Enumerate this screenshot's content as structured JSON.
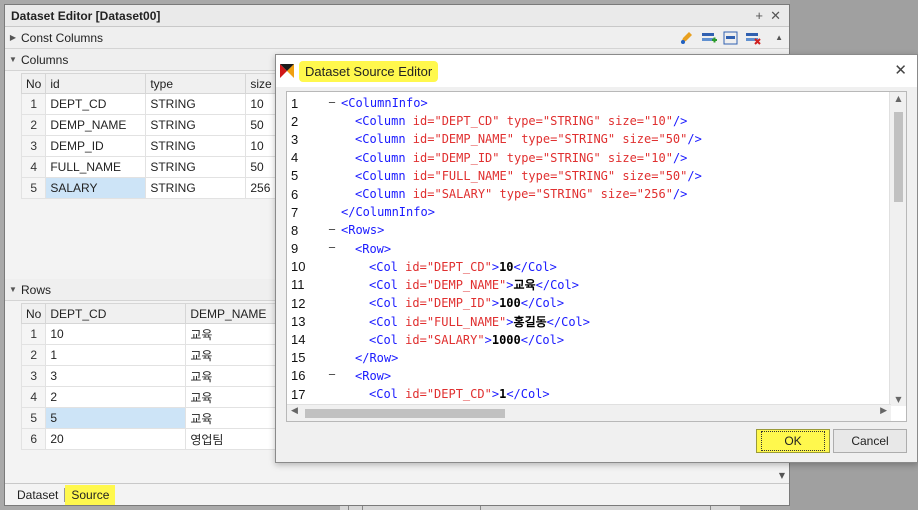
{
  "editor": {
    "title": "Dataset Editor [Dataset00]",
    "pin": "+",
    "close": "✕",
    "const_columns": "Const Columns",
    "columns_section": "Columns",
    "rows_section": "Rows",
    "columns_headers": [
      "No",
      "id",
      "type",
      "size"
    ],
    "columns_rows": [
      {
        "no": "1",
        "id": "DEPT_CD",
        "type": "STRING",
        "size": "10"
      },
      {
        "no": "2",
        "id": "DEMP_NAME",
        "type": "STRING",
        "size": "50"
      },
      {
        "no": "3",
        "id": "DEMP_ID",
        "type": "STRING",
        "size": "10"
      },
      {
        "no": "4",
        "id": "FULL_NAME",
        "type": "STRING",
        "size": "50"
      },
      {
        "no": "5",
        "id": "SALARY",
        "type": "STRING",
        "size": "256"
      }
    ],
    "rows_headers": [
      "No",
      "DEPT_CD",
      "DEMP_NAME"
    ],
    "rows_data": [
      {
        "no": "1",
        "a": "10",
        "b": "교육"
      },
      {
        "no": "2",
        "a": "1",
        "b": "교육"
      },
      {
        "no": "3",
        "a": "3",
        "b": "교육"
      },
      {
        "no": "4",
        "a": "2",
        "b": "교육"
      },
      {
        "no": "5",
        "a": "5",
        "b": "교육"
      },
      {
        "no": "6",
        "a": "20",
        "b": "영업팀"
      }
    ],
    "tabs": {
      "dataset": "Dataset",
      "source": "Source"
    }
  },
  "dialog": {
    "title": "Dataset Source Editor",
    "close": "✕",
    "ok": "OK",
    "cancel": "Cancel",
    "lines": [
      {
        "n": "1",
        "fold": "─",
        "ind": 0,
        "parts": [
          [
            "tag",
            "<ColumnInfo>"
          ]
        ]
      },
      {
        "n": "2",
        "fold": "",
        "ind": 1,
        "parts": [
          [
            "tag",
            "<Column "
          ],
          [
            "attr",
            "id="
          ],
          [
            "val",
            "\"DEPT_CD\""
          ],
          [
            "attr",
            " type="
          ],
          [
            "val",
            "\"STRING\""
          ],
          [
            "attr",
            " size="
          ],
          [
            "val",
            "\"10\""
          ],
          [
            "tag",
            "/>"
          ]
        ]
      },
      {
        "n": "3",
        "fold": "",
        "ind": 1,
        "parts": [
          [
            "tag",
            "<Column "
          ],
          [
            "attr",
            "id="
          ],
          [
            "val",
            "\"DEMP_NAME\""
          ],
          [
            "attr",
            " type="
          ],
          [
            "val",
            "\"STRING\""
          ],
          [
            "attr",
            " size="
          ],
          [
            "val",
            "\"50\""
          ],
          [
            "tag",
            "/>"
          ]
        ]
      },
      {
        "n": "4",
        "fold": "",
        "ind": 1,
        "parts": [
          [
            "tag",
            "<Column "
          ],
          [
            "attr",
            "id="
          ],
          [
            "val",
            "\"DEMP_ID\""
          ],
          [
            "attr",
            " type="
          ],
          [
            "val",
            "\"STRING\""
          ],
          [
            "attr",
            " size="
          ],
          [
            "val",
            "\"10\""
          ],
          [
            "tag",
            "/>"
          ]
        ]
      },
      {
        "n": "5",
        "fold": "",
        "ind": 1,
        "parts": [
          [
            "tag",
            "<Column "
          ],
          [
            "attr",
            "id="
          ],
          [
            "val",
            "\"FULL_NAME\""
          ],
          [
            "attr",
            " type="
          ],
          [
            "val",
            "\"STRING\""
          ],
          [
            "attr",
            " size="
          ],
          [
            "val",
            "\"50\""
          ],
          [
            "tag",
            "/>"
          ]
        ]
      },
      {
        "n": "6",
        "fold": "",
        "ind": 1,
        "parts": [
          [
            "tag",
            "<Column "
          ],
          [
            "attr",
            "id="
          ],
          [
            "val",
            "\"SALARY\""
          ],
          [
            "attr",
            " type="
          ],
          [
            "val",
            "\"STRING\""
          ],
          [
            "attr",
            " size="
          ],
          [
            "val",
            "\"256\""
          ],
          [
            "tag",
            "/>"
          ]
        ]
      },
      {
        "n": "7",
        "fold": "",
        "ind": 0,
        "parts": [
          [
            "tag",
            "</ColumnInfo>"
          ]
        ]
      },
      {
        "n": "8",
        "fold": "─",
        "ind": 0,
        "parts": [
          [
            "tag",
            "<Rows>"
          ]
        ]
      },
      {
        "n": "9",
        "fold": "─",
        "ind": 1,
        "parts": [
          [
            "tag",
            "<Row>"
          ]
        ]
      },
      {
        "n": "10",
        "fold": "",
        "ind": 2,
        "parts": [
          [
            "tag",
            "<Col "
          ],
          [
            "attr",
            "id="
          ],
          [
            "val",
            "\"DEPT_CD\""
          ],
          [
            "tag",
            ">"
          ],
          [
            "txt",
            "10"
          ],
          [
            "tag",
            "</Col>"
          ]
        ]
      },
      {
        "n": "11",
        "fold": "",
        "ind": 2,
        "parts": [
          [
            "tag",
            "<Col "
          ],
          [
            "attr",
            "id="
          ],
          [
            "val",
            "\"DEMP_NAME\""
          ],
          [
            "tag",
            ">"
          ],
          [
            "txt",
            "교육"
          ],
          [
            "tag",
            "</Col>"
          ]
        ]
      },
      {
        "n": "12",
        "fold": "",
        "ind": 2,
        "parts": [
          [
            "tag",
            "<Col "
          ],
          [
            "attr",
            "id="
          ],
          [
            "val",
            "\"DEMP_ID\""
          ],
          [
            "tag",
            ">"
          ],
          [
            "txt",
            "100"
          ],
          [
            "tag",
            "</Col>"
          ]
        ]
      },
      {
        "n": "13",
        "fold": "",
        "ind": 2,
        "parts": [
          [
            "tag",
            "<Col "
          ],
          [
            "attr",
            "id="
          ],
          [
            "val",
            "\"FULL_NAME\""
          ],
          [
            "tag",
            ">"
          ],
          [
            "txt",
            "홍길동"
          ],
          [
            "tag",
            "</Col>"
          ]
        ]
      },
      {
        "n": "14",
        "fold": "",
        "ind": 2,
        "parts": [
          [
            "tag",
            "<Col "
          ],
          [
            "attr",
            "id="
          ],
          [
            "val",
            "\"SALARY\""
          ],
          [
            "tag",
            ">"
          ],
          [
            "txt",
            "1000"
          ],
          [
            "tag",
            "</Col>"
          ]
        ]
      },
      {
        "n": "15",
        "fold": "",
        "ind": 1,
        "parts": [
          [
            "tag",
            "</Row>"
          ]
        ]
      },
      {
        "n": "16",
        "fold": "─",
        "ind": 1,
        "parts": [
          [
            "tag",
            "<Row>"
          ]
        ]
      },
      {
        "n": "17",
        "fold": "",
        "ind": 2,
        "parts": [
          [
            "tag",
            "<Col "
          ],
          [
            "attr",
            "id="
          ],
          [
            "val",
            "\"DEPT_CD\""
          ],
          [
            "tag",
            ">"
          ],
          [
            "txt",
            "1"
          ],
          [
            "tag",
            "</Col>"
          ]
        ]
      }
    ]
  },
  "colors": {
    "highlight": "#fff84d",
    "selection": "#cde4f7",
    "tag": "#1a1aff",
    "attr": "#e03030"
  }
}
